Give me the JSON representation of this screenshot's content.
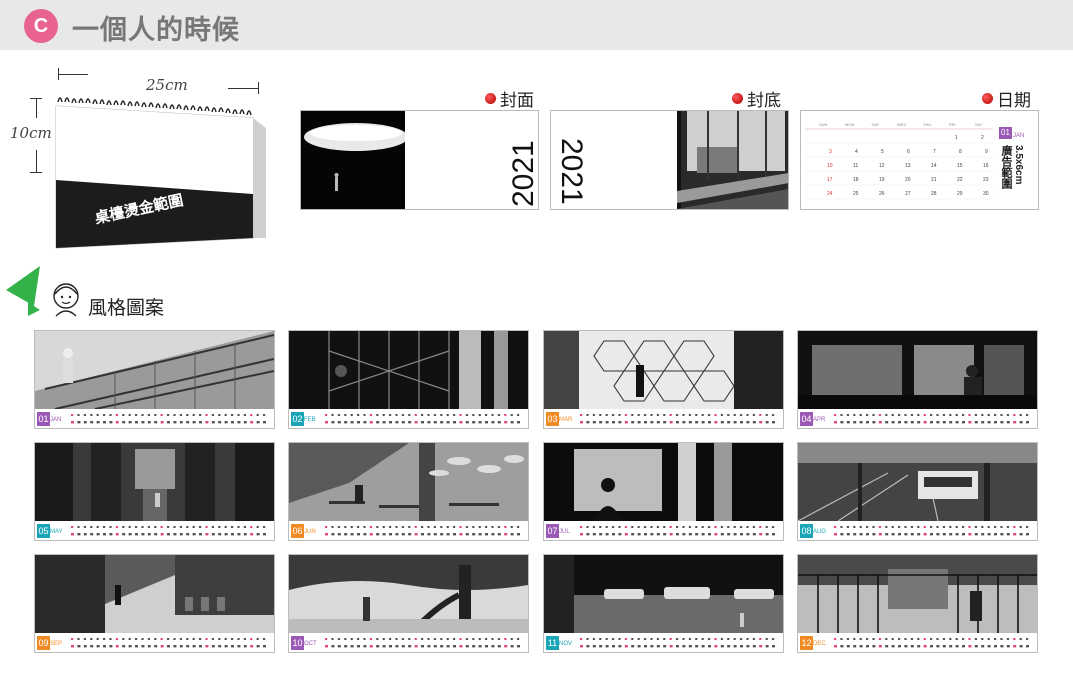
{
  "header": {
    "badge": "C",
    "title": "一個人的時候"
  },
  "desk_calendar": {
    "width_label": "25cm",
    "height_label": "10cm",
    "base_text": "桌檯燙金範圍"
  },
  "previews": [
    {
      "label": "封面",
      "year": "2021"
    },
    {
      "label": "封底",
      "year": "2021"
    },
    {
      "label": "日期",
      "ad_text": "廣告範圍",
      "ad_size": "3.5x6cm",
      "month_num": "01",
      "month_name": "JAN"
    }
  ],
  "styles_section": {
    "label": "風格圖案"
  },
  "months": [
    {
      "num": "01",
      "name": "JAN",
      "color": "#9b59b6",
      "scene": "escalator"
    },
    {
      "num": "02",
      "name": "FEB",
      "color": "#1aa6b7",
      "scene": "gate"
    },
    {
      "num": "03",
      "name": "MAR",
      "color": "#f08a24",
      "scene": "glass"
    },
    {
      "num": "04",
      "name": "APR",
      "color": "#9b59b6",
      "scene": "window"
    },
    {
      "num": "05",
      "name": "MAY",
      "color": "#1aa6b7",
      "scene": "hall"
    },
    {
      "num": "06",
      "name": "JUN",
      "color": "#f08a24",
      "scene": "cafe"
    },
    {
      "num": "07",
      "name": "JUL",
      "color": "#9b59b6",
      "scene": "screen"
    },
    {
      "num": "08",
      "name": "AUG",
      "color": "#1aa6b7",
      "scene": "train"
    },
    {
      "num": "09",
      "name": "SEP",
      "color": "#f08a24",
      "scene": "alley"
    },
    {
      "num": "10",
      "name": "OCT",
      "color": "#9b59b6",
      "scene": "park"
    },
    {
      "num": "11",
      "name": "NOV",
      "color": "#1aa6b7",
      "scene": "street"
    },
    {
      "num": "12",
      "name": "DEC",
      "color": "#f08a24",
      "scene": "fence"
    }
  ]
}
